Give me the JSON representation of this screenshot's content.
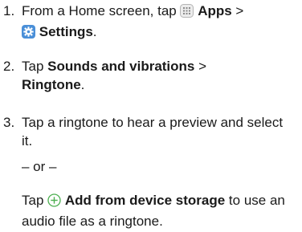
{
  "steps": [
    {
      "number": "1.",
      "pre_apps": "From a Home screen, tap ",
      "apps_label": "Apps",
      "separator": " >",
      "settings_label": "Settings",
      "settings_suffix": ".",
      "apps_icon": "apps-grid-icon",
      "settings_icon": "settings-gear-icon"
    },
    {
      "number": "2.",
      "pre": "Tap ",
      "sounds_label": "Sounds and vibrations",
      "separator": " >",
      "ringtone_label": "Ringtone",
      "suffix": "."
    },
    {
      "number": "3.",
      "text": "Tap a ringtone to hear a preview and select it."
    }
  ],
  "or_text": "– or –",
  "alternative": {
    "pre": "Tap ",
    "icon": "plus-circle-icon",
    "bold_label": "Add from device storage",
    "post": " to use an audio file as a ringtone."
  },
  "colors": {
    "text": "#1a1a1a",
    "settings_icon_bg": "#4a8fd8",
    "plus_icon": "#4caf50",
    "apps_icon": "#9e9e9e"
  }
}
